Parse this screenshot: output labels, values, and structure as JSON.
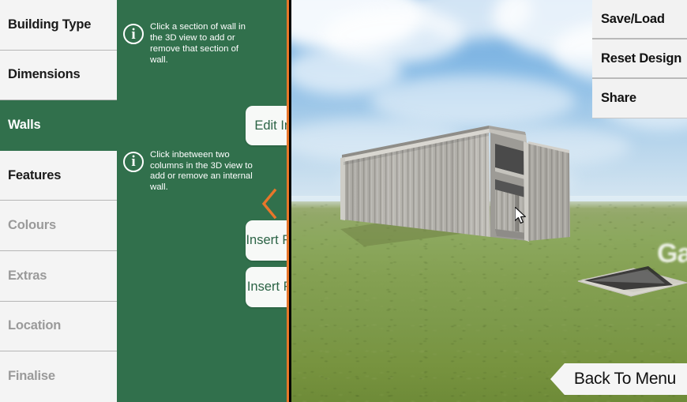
{
  "sidebar": {
    "items": [
      {
        "label": "Building Type",
        "state": "enabled"
      },
      {
        "label": "Dimensions",
        "state": "enabled"
      },
      {
        "label": "Walls",
        "state": "active"
      },
      {
        "label": "Features",
        "state": "enabled"
      },
      {
        "label": "Colours",
        "state": "disabled"
      },
      {
        "label": "Extras",
        "state": "disabled"
      },
      {
        "label": "Location",
        "state": "disabled"
      },
      {
        "label": "Finalise",
        "state": "disabled"
      }
    ]
  },
  "panel": {
    "info_1": "Click a section of wall in the 3D view to add or remove that section of wall.",
    "info_2": "Click inbetween two columns in the 3D view to add or remove an internal wall.",
    "info_icon_glyph": "i",
    "btn_edit_internal_walls": "Edit Internal Walls",
    "btn_insert_front_garaport": "Insert Front Garaport",
    "btn_insert_rear_garaport": "Insert Rear Garaport",
    "collapse_icon": "chevron-left-icon",
    "accent_color": "#e8762a",
    "panel_color": "#31704c",
    "button_text_color": "#2b6345"
  },
  "top_menu": {
    "items": [
      {
        "label": "Save/Load"
      },
      {
        "label": "Reset Design"
      },
      {
        "label": "Share"
      }
    ]
  },
  "footer": {
    "back_to_menu": "Back To Menu"
  },
  "viewport": {
    "scene": "3d-shed-design-preview",
    "watermark_text": "Ga",
    "cursor_icon": "mouse-pointer-icon",
    "sky_color": "#86bae5",
    "ground_color": "#84a052",
    "building_wall_color": "#b4b2ac"
  }
}
